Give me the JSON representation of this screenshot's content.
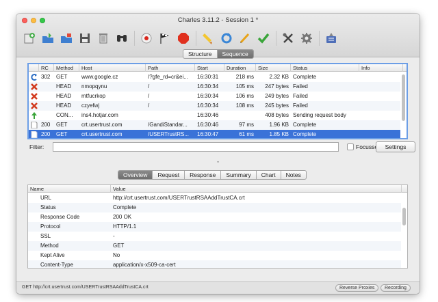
{
  "window": {
    "title": "Charles 3.11.2 - Session 1 *"
  },
  "toolbar": {
    "icons": [
      "new-session-icon",
      "open-icon",
      "import-icon",
      "save-icon",
      "trash-icon",
      "find-icon",
      "record-icon",
      "throttle-icon",
      "stop-icon",
      "edit-icon",
      "repeat-icon",
      "compose-icon",
      "validate-icon",
      "tools-icon",
      "settings-icon",
      "upload-icon"
    ]
  },
  "view_switch": {
    "items": [
      "Structure",
      "Sequence"
    ],
    "active": 1
  },
  "table": {
    "columns": [
      "RC",
      "Method",
      "Host",
      "Path",
      "Start",
      "Duration",
      "Size",
      "Status",
      "Info"
    ],
    "rows": [
      {
        "icon": "redirect-icon",
        "rc": "302",
        "method": "GET",
        "host": "www.google.cz",
        "path": "/?gfe_rd=cr&ei...",
        "start": "16:30:31",
        "duration": "218 ms",
        "size": "2.32 KB",
        "status": "Complete",
        "info": ""
      },
      {
        "icon": "failed-icon",
        "rc": "",
        "method": "HEAD",
        "host": "nmopqynu",
        "path": "/",
        "start": "16:30:34",
        "duration": "105 ms",
        "size": "247 bytes",
        "status": "Failed",
        "info": ""
      },
      {
        "icon": "failed-icon",
        "rc": "",
        "method": "HEAD",
        "host": "mtfucrkop",
        "path": "/",
        "start": "16:30:34",
        "duration": "106 ms",
        "size": "249 bytes",
        "status": "Failed",
        "info": ""
      },
      {
        "icon": "failed-icon",
        "rc": "",
        "method": "HEAD",
        "host": "czyefwj",
        "path": "/",
        "start": "16:30:34",
        "duration": "108 ms",
        "size": "245 bytes",
        "status": "Failed",
        "info": ""
      },
      {
        "icon": "upload-arrow-icon",
        "rc": "",
        "method": "CON...",
        "host": "ins4.hotjar.com",
        "path": "",
        "start": "16:30:46",
        "duration": "",
        "size": "408 bytes",
        "status": "Sending request body",
        "info": ""
      },
      {
        "icon": "document-icon",
        "rc": "200",
        "method": "GET",
        "host": "crt.usertrust.com",
        "path": "/GandiStandar...",
        "start": "16:30:46",
        "duration": "97 ms",
        "size": "1.96 KB",
        "status": "Complete",
        "info": ""
      },
      {
        "icon": "document-icon",
        "rc": "200",
        "method": "GET",
        "host": "crt.usertrust.com",
        "path": "/USERTrustRS...",
        "start": "16:30:47",
        "duration": "61 ms",
        "size": "1.85 KB",
        "status": "Complete",
        "info": ""
      }
    ],
    "selected": 6
  },
  "filter": {
    "label": "Filter:",
    "value": "",
    "focussed_label": "Focussed",
    "focussed_checked": false,
    "settings_label": "Settings"
  },
  "splitter": {
    "glyph": "⌃"
  },
  "detail_tabs": {
    "items": [
      "Overview",
      "Request",
      "Response",
      "Summary",
      "Chart",
      "Notes"
    ],
    "active": 0
  },
  "detail": {
    "columns": [
      "Name",
      "Value"
    ],
    "rows": [
      {
        "name": "URL",
        "value": "http://crt.usertrust.com/USERTrustRSAAddTrustCA.crt"
      },
      {
        "name": "Status",
        "value": "Complete"
      },
      {
        "name": "Response Code",
        "value": "200 OK"
      },
      {
        "name": "Protocol",
        "value": "HTTP/1.1"
      },
      {
        "name": "SSL",
        "value": "-"
      },
      {
        "name": "Method",
        "value": "GET"
      },
      {
        "name": "Kept Alive",
        "value": "No"
      },
      {
        "name": "Content-Type",
        "value": "application/x-x509-ca-cert"
      }
    ]
  },
  "statusbar": {
    "text": "GET http://crt.usertrust.com/USERTrustRSAAddTrustCA.crt",
    "reverse_proxies_label": "Reverse Proxies",
    "recording_label": "Recording"
  },
  "colors": {
    "selection": "#3a72d8",
    "focus_ring": "#6c9ee6",
    "failed": "#d23a1e",
    "redirect": "#2e6fc4",
    "success": "#3aa53a"
  }
}
